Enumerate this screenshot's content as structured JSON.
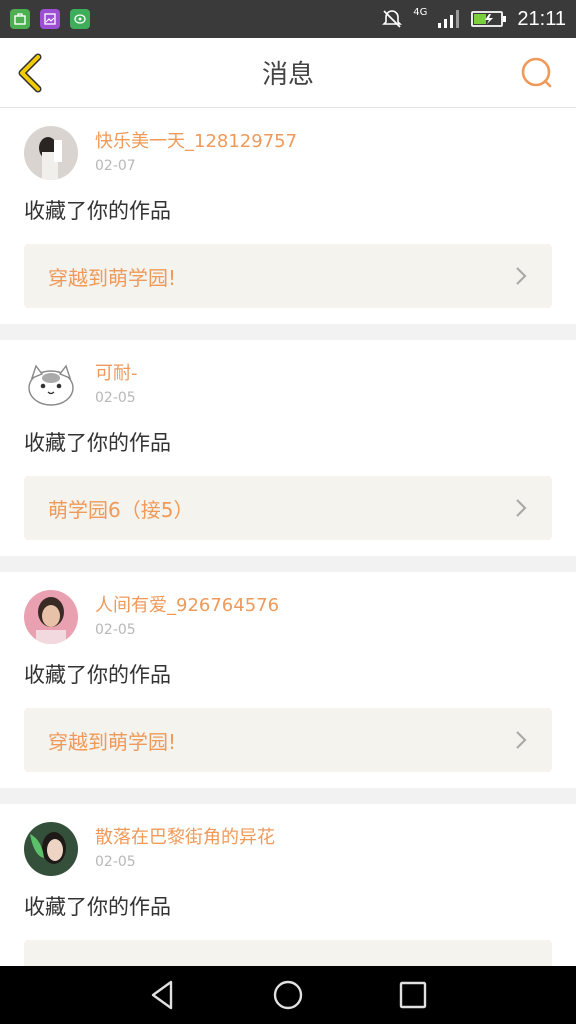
{
  "status": {
    "time": "21:11",
    "network": "4G"
  },
  "header": {
    "title": "消息"
  },
  "messages": [
    {
      "user": "快乐美一天_128129757",
      "date": "02-07",
      "action": "收藏了你的作品",
      "work": "穿越到萌学园!"
    },
    {
      "user": "可耐-",
      "date": "02-05",
      "action": "收藏了你的作品",
      "work": "萌学园6（接5）"
    },
    {
      "user": "人间有爱_926764576",
      "date": "02-05",
      "action": "收藏了你的作品",
      "work": "穿越到萌学园!"
    },
    {
      "user": "散落在巴黎街角的异花",
      "date": "02-05",
      "action": "收藏了你的作品",
      "work": ""
    }
  ],
  "colors": {
    "accent": "#ef9a5a",
    "back_arrow": "#e8c200",
    "status_bar": "#3a3a3a"
  }
}
